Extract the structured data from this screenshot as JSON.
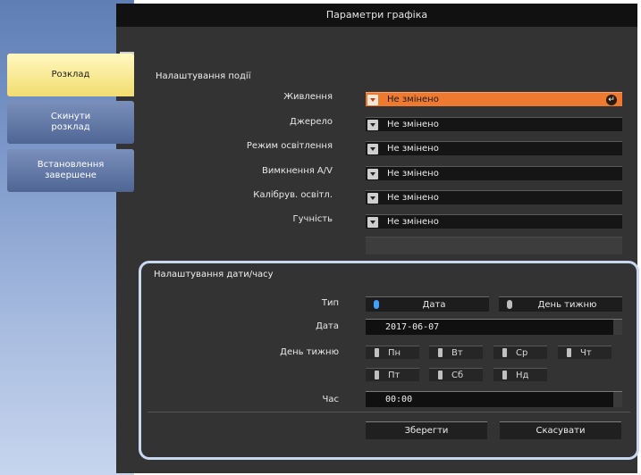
{
  "window": {
    "title": "Параметри графіка"
  },
  "sidebar": {
    "items": [
      {
        "label": "Розклад",
        "active": true
      },
      {
        "label": "Скинути\nрозклад",
        "active": false
      },
      {
        "label": "Встановлення\nзавершене",
        "active": false
      }
    ]
  },
  "event_settings": {
    "heading": "Налаштування події",
    "rows": [
      {
        "label": "Живлення",
        "value": "Не змінено",
        "highlighted": true
      },
      {
        "label": "Джерело",
        "value": "Не змінено"
      },
      {
        "label": "Режим освітлення",
        "value": "Не змінено"
      },
      {
        "label": "Вимкнення A/V",
        "value": "Не змінено"
      },
      {
        "label": "Калібрув. освітл.",
        "value": "Не змінено"
      },
      {
        "label": "Гучність",
        "value": "Не змінено"
      }
    ]
  },
  "datetime": {
    "heading": "Налаштування дати/часу",
    "type_label": "Тип",
    "type_options": [
      {
        "label": "Дата",
        "selected": true
      },
      {
        "label": "День тижню",
        "selected": false
      }
    ],
    "date_label": "Дата",
    "date_value": "2017-06-07",
    "weekday_label": "День тижню",
    "weekdays": [
      "Пн",
      "Вт",
      "Ср",
      "Чт",
      "Пт",
      "Сб",
      "Нд"
    ],
    "time_label": "Час",
    "time_value": "00:00"
  },
  "actions": {
    "save": "Зберегти",
    "cancel": "Скасувати"
  },
  "colors": {
    "accent_orange": "#ee7a32",
    "active_tab": "#f2dd6f",
    "selected_radio": "#3ea0ff",
    "focus_frame": "#c8d8f0"
  }
}
